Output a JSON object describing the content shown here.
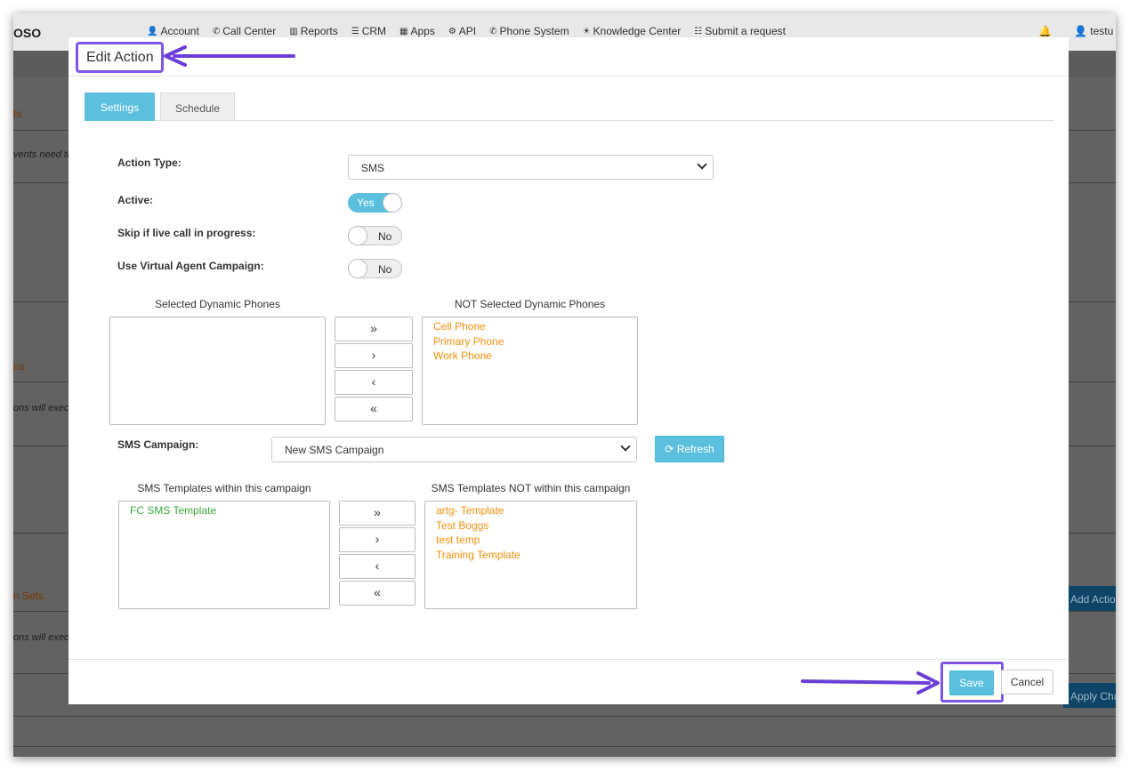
{
  "background": {
    "brand": "OSO",
    "nav": [
      {
        "icon": "user-icon",
        "glyph": "👤",
        "label": "Account"
      },
      {
        "icon": "phone-icon",
        "glyph": "✆",
        "label": "Call Center"
      },
      {
        "icon": "bar-chart-icon",
        "glyph": "▥",
        "label": "Reports"
      },
      {
        "icon": "list-icon",
        "glyph": "☰",
        "label": "CRM"
      },
      {
        "icon": "grid-icon",
        "glyph": "▦",
        "label": "Apps"
      },
      {
        "icon": "gear-icon",
        "glyph": "⚙",
        "label": "API"
      },
      {
        "icon": "phone-icon",
        "glyph": "✆",
        "label": "Phone System"
      },
      {
        "icon": "lightbulb-icon",
        "glyph": "☀",
        "label": "Knowledge Center"
      },
      {
        "icon": "ticket-icon",
        "glyph": "☷",
        "label": "Submit a request"
      }
    ],
    "bell_glyph": "🔔",
    "user_label": "testu",
    "side_texts": [
      "ts",
      "vents need to",
      "ns",
      "ons will execu",
      "n Sets",
      "ons will execu"
    ],
    "add_action_label": "Add Actio",
    "apply_label": "Apply Cha"
  },
  "modal": {
    "title": "Edit Action",
    "tabs": [
      {
        "label": "Settings",
        "active": true
      },
      {
        "label": "Schedule",
        "active": false
      }
    ],
    "action_type": {
      "label": "Action Type:",
      "value": "SMS"
    },
    "active": {
      "label": "Active:",
      "state": "Yes"
    },
    "skip_live_call": {
      "label": "Skip if live call in progress:",
      "state": "No"
    },
    "virtual_agent": {
      "label": "Use Virtual Agent Campaign:",
      "state": "No"
    },
    "dynamic_phones": {
      "selected_title": "Selected Dynamic Phones",
      "selected": [],
      "not_selected_title": "NOT Selected Dynamic Phones",
      "not_selected": [
        "Cell Phone",
        "Primary Phone",
        "Work Phone"
      ]
    },
    "mover_buttons": [
      "»",
      "›",
      "‹",
      "«"
    ],
    "sms_campaign": {
      "label": "SMS Campaign:",
      "value": "New SMS Campaign",
      "refresh_label": "Refresh",
      "refresh_glyph": "⟳"
    },
    "sms_templates": {
      "within_title": "SMS Templates within this campaign",
      "within": [
        "FC SMS Template"
      ],
      "not_within_title": "SMS Templates NOT within this campaign",
      "not_within": [
        "artg- Template",
        "Test Boggs",
        "test temp",
        "Training Template"
      ]
    },
    "footer": {
      "save_label": "Save",
      "cancel_label": "Cancel"
    }
  },
  "colors": {
    "accent": "#5bc0de",
    "highlight": "#7e56e6",
    "orange_item": "#f0900c",
    "green_item": "#3aa83a"
  }
}
